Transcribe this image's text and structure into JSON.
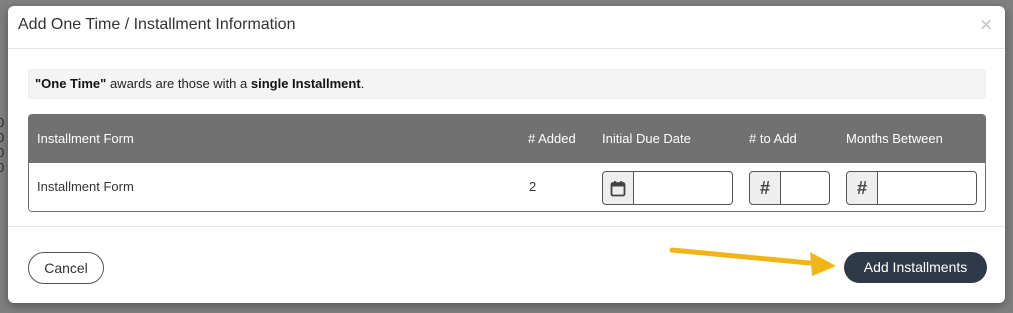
{
  "modal": {
    "title": "Add One Time / Installment Information",
    "close_glyph": "×"
  },
  "info": {
    "prefix": "\"One Time\"",
    "middle": " awards are those with a ",
    "emphasis": "single Installment",
    "suffix": "."
  },
  "table": {
    "headers": [
      "Installment Form",
      "# Added",
      "Initial Due Date",
      "# to Add",
      "Months Between"
    ],
    "rows": [
      {
        "form": "Installment Form",
        "added": "2",
        "initial_due_date": "",
        "to_add": "",
        "months_between": ""
      }
    ]
  },
  "icons": {
    "calendar": "calendar-icon",
    "hash": "#"
  },
  "footer": {
    "cancel_label": "Cancel",
    "add_label": "Add Installments"
  },
  "colors": {
    "header_bg": "#717171",
    "primary_button": "#2e3a4a",
    "arrow": "#f2b517"
  }
}
